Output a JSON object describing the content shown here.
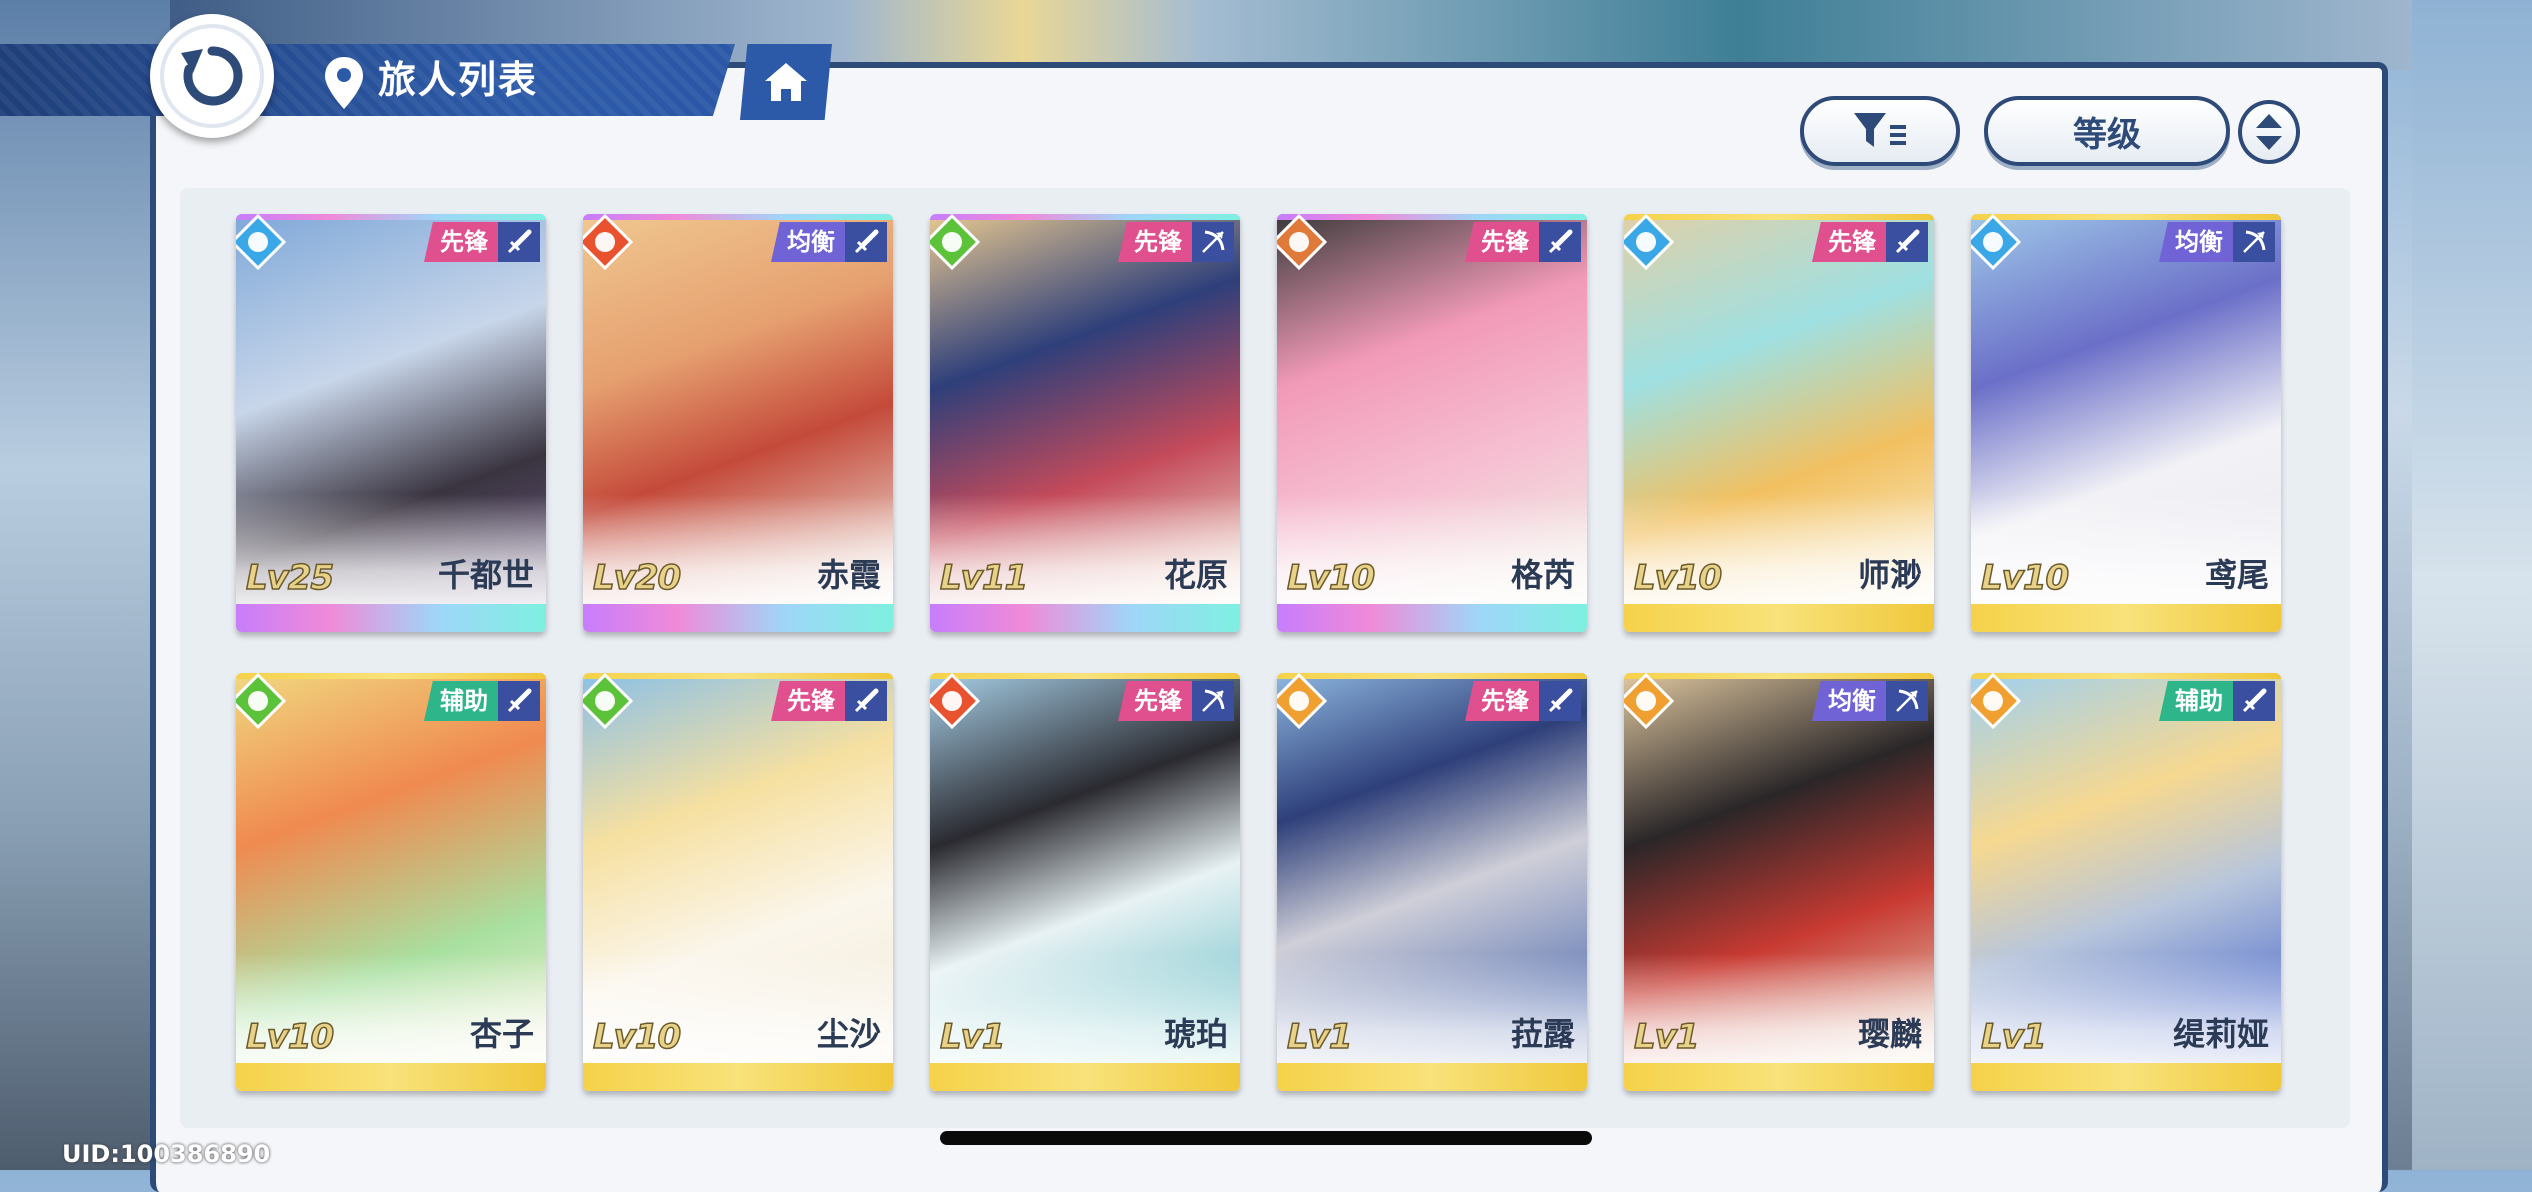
{
  "header": {
    "title": "旅人列表"
  },
  "sort": {
    "label": "等级"
  },
  "roster": [
    {
      "name": "千都世",
      "level": "Lv25",
      "role": "先锋",
      "element": "water",
      "weapon": "sword",
      "role_color": "#e0508f",
      "frame": "rainbow"
    },
    {
      "name": "赤霞",
      "level": "Lv20",
      "role": "均衡",
      "element": "fire",
      "weapon": "sword",
      "role_color": "#6f63d6",
      "frame": "rainbow"
    },
    {
      "name": "花原",
      "level": "Lv11",
      "role": "先锋",
      "element": "wind",
      "weapon": "bow",
      "role_color": "#e0508f",
      "frame": "rainbow"
    },
    {
      "name": "格芮",
      "level": "Lv10",
      "role": "先锋",
      "element": "earth",
      "weapon": "sword",
      "role_color": "#e0508f",
      "frame": "rainbow"
    },
    {
      "name": "师渺",
      "level": "Lv10",
      "role": "先锋",
      "element": "water",
      "weapon": "sword",
      "role_color": "#e0508f",
      "frame": "gold"
    },
    {
      "name": "鸢尾",
      "level": "Lv10",
      "role": "均衡",
      "element": "water",
      "weapon": "bow",
      "role_color": "#6f63d6",
      "frame": "gold"
    },
    {
      "name": "杏子",
      "level": "Lv10",
      "role": "辅助",
      "element": "wind",
      "weapon": "sword",
      "role_color": "#2fb58a",
      "frame": "gold"
    },
    {
      "name": "尘沙",
      "level": "Lv10",
      "role": "先锋",
      "element": "wind",
      "weapon": "sword",
      "role_color": "#e0508f",
      "frame": "gold"
    },
    {
      "name": "琥珀",
      "level": "Lv1",
      "role": "先锋",
      "element": "fire",
      "weapon": "bow",
      "role_color": "#e0508f",
      "frame": "gold"
    },
    {
      "name": "菈露",
      "level": "Lv1",
      "role": "先锋",
      "element": "light",
      "weapon": "sword",
      "role_color": "#e0508f",
      "frame": "gold"
    },
    {
      "name": "璎麟",
      "level": "Lv1",
      "role": "均衡",
      "element": "light",
      "weapon": "bow",
      "role_color": "#6f63d6",
      "frame": "gold"
    },
    {
      "name": "缇莉娅",
      "level": "Lv1",
      "role": "辅助",
      "element": "light",
      "weapon": "sword",
      "role_color": "#2fb58a",
      "frame": "gold"
    }
  ],
  "footer": {
    "uid": "UID:100386890"
  },
  "colors": {
    "navy": "#2e4a78",
    "water": "#3aa7e6",
    "fire": "#e8522e",
    "wind": "#5cc23a",
    "earth": "#e07a3a",
    "light": "#f0a030"
  }
}
